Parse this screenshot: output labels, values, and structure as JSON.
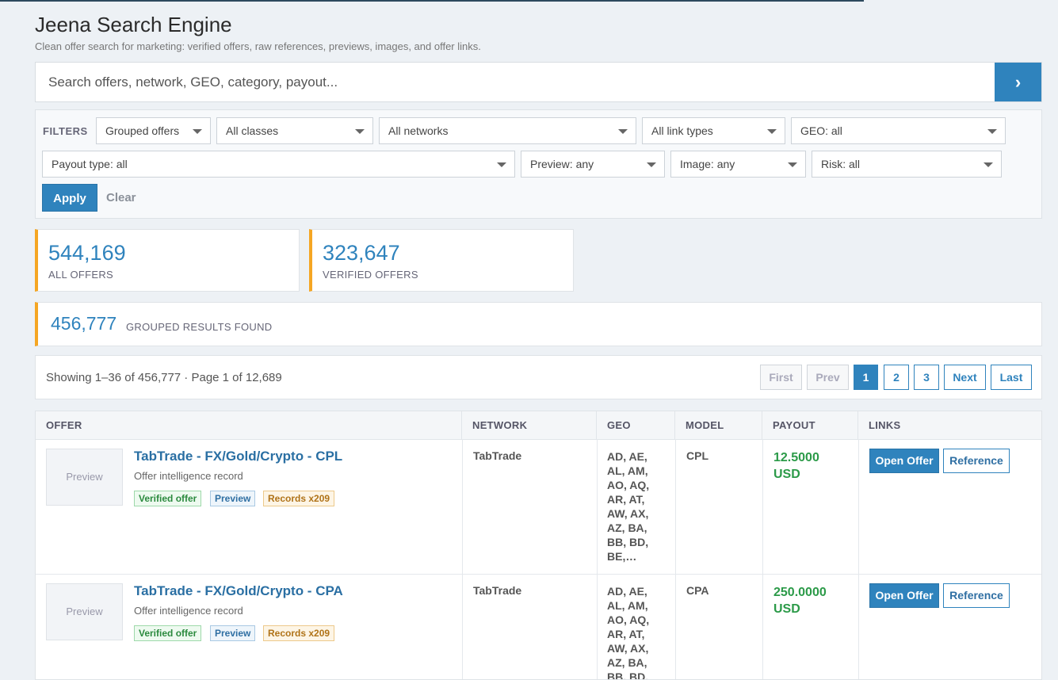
{
  "header": {
    "title": "Jeena Search Engine",
    "subtitle": "Clean offer search for marketing: verified offers, raw references, previews, images, and offer links."
  },
  "search": {
    "placeholder": "Search offers, network, GEO, category, payout...",
    "button_label": "›"
  },
  "filters": {
    "label": "FILTERS",
    "selects": {
      "grouping": "Grouped offers",
      "classes": "All classes",
      "networks": "All networks",
      "link_types": "All link types",
      "geo": "GEO: all",
      "payout_type": "Payout type: all",
      "preview": "Preview: any",
      "image": "Image: any",
      "risk": "Risk: all"
    },
    "apply_label": "Apply",
    "clear_label": "Clear"
  },
  "stats": {
    "all_offers": {
      "value": "544,169",
      "label": "ALL OFFERS"
    },
    "verified_offers": {
      "value": "323,647",
      "label": "VERIFIED OFFERS"
    }
  },
  "found": {
    "value": "456,777",
    "label": "GROUPED RESULTS FOUND"
  },
  "pagination": {
    "showing": "Showing 1–36 of 456,777 · Page 1 of 12,689",
    "first": "First",
    "prev": "Prev",
    "pages": [
      "1",
      "2",
      "3"
    ],
    "next": "Next",
    "last": "Last"
  },
  "table": {
    "columns": {
      "offer": "OFFER",
      "network": "NETWORK",
      "geo": "GEO",
      "model": "MODEL",
      "payout": "PAYOUT",
      "links": "LINKS"
    },
    "rows": [
      {
        "preview": "Preview",
        "title": "TabTrade - FX/Gold/Crypto - CPL",
        "desc": "Offer intelligence record",
        "badges": [
          "Verified offer",
          "Preview",
          "Records x209"
        ],
        "network": "TabTrade",
        "geo": "AD, AE, AL, AM, AO, AQ, AR, AT, AW, AX, AZ, BA, BB, BD, BE,…",
        "model": "CPL",
        "payout": "12.5000 USD",
        "open_label": "Open Offer",
        "ref_label": "Reference"
      },
      {
        "preview": "Preview",
        "title": "TabTrade - FX/Gold/Crypto - CPA",
        "desc": "Offer intelligence record",
        "badges": [
          "Verified offer",
          "Preview",
          "Records x209"
        ],
        "network": "TabTrade",
        "geo": "AD, AE, AL, AM, AO, AQ, AR, AT, AW, AX, AZ, BA, BB, BD,",
        "model": "CPA",
        "payout": "250.0000 USD",
        "open_label": "Open Offer",
        "ref_label": "Reference"
      }
    ]
  }
}
